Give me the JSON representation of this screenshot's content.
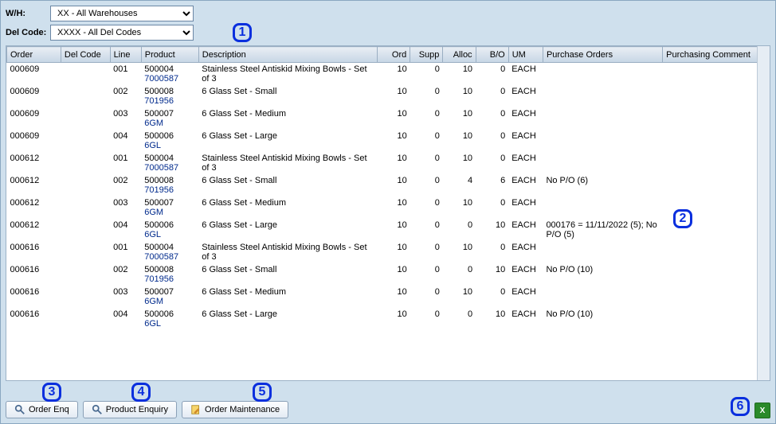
{
  "filters": {
    "wh_label": "W/H:",
    "wh_value": "XX - All Warehouses",
    "del_label": "Del Code:",
    "del_value": "XXXX - All Del Codes"
  },
  "columns": {
    "order": "Order",
    "del_code": "Del Code",
    "line": "Line",
    "product": "Product",
    "description": "Description",
    "ord": "Ord",
    "supp": "Supp",
    "alloc": "Alloc",
    "bo": "B/O",
    "um": "UM",
    "po": "Purchase Orders",
    "pc": "Purchasing Comment"
  },
  "rows": [
    {
      "order": "000609",
      "del": "",
      "line": "001",
      "prod1": "500004",
      "prod2": "7000587",
      "desc": "Stainless Steel Antiskid Mixing Bowls - Set of 3",
      "ord": "10",
      "supp": "0",
      "alloc": "10",
      "bo": "0",
      "um": "EACH",
      "po": "",
      "pc": ""
    },
    {
      "order": "000609",
      "del": "",
      "line": "002",
      "prod1": "500008",
      "prod2": "701956",
      "desc": "6 Glass Set - Small",
      "ord": "10",
      "supp": "0",
      "alloc": "10",
      "bo": "0",
      "um": "EACH",
      "po": "",
      "pc": ""
    },
    {
      "order": "000609",
      "del": "",
      "line": "003",
      "prod1": "500007",
      "prod2": "6GM",
      "desc": "6 Glass Set - Medium",
      "ord": "10",
      "supp": "0",
      "alloc": "10",
      "bo": "0",
      "um": "EACH",
      "po": "",
      "pc": ""
    },
    {
      "order": "000609",
      "del": "",
      "line": "004",
      "prod1": "500006",
      "prod2": "6GL",
      "desc": "6 Glass Set - Large",
      "ord": "10",
      "supp": "0",
      "alloc": "10",
      "bo": "0",
      "um": "EACH",
      "po": "",
      "pc": ""
    },
    {
      "order": "000612",
      "del": "",
      "line": "001",
      "prod1": "500004",
      "prod2": "7000587",
      "desc": "Stainless Steel Antiskid Mixing Bowls - Set of 3",
      "ord": "10",
      "supp": "0",
      "alloc": "10",
      "bo": "0",
      "um": "EACH",
      "po": "",
      "pc": ""
    },
    {
      "order": "000612",
      "del": "",
      "line": "002",
      "prod1": "500008",
      "prod2": "701956",
      "desc": "6 Glass Set - Small",
      "ord": "10",
      "supp": "0",
      "alloc": "4",
      "bo": "6",
      "um": "EACH",
      "po": "No P/O (6)",
      "pc": ""
    },
    {
      "order": "000612",
      "del": "",
      "line": "003",
      "prod1": "500007",
      "prod2": "6GM",
      "desc": "6 Glass Set - Medium",
      "ord": "10",
      "supp": "0",
      "alloc": "10",
      "bo": "0",
      "um": "EACH",
      "po": "",
      "pc": ""
    },
    {
      "order": "000612",
      "del": "",
      "line": "004",
      "prod1": "500006",
      "prod2": "6GL",
      "desc": "6 Glass Set - Large",
      "ord": "10",
      "supp": "0",
      "alloc": "0",
      "bo": "10",
      "um": "EACH",
      "po": "000176 = 11/11/2022 (5); No P/O (5)",
      "pc": ""
    },
    {
      "order": "000616",
      "del": "",
      "line": "001",
      "prod1": "500004",
      "prod2": "7000587",
      "desc": "Stainless Steel Antiskid Mixing Bowls - Set of 3",
      "ord": "10",
      "supp": "0",
      "alloc": "10",
      "bo": "0",
      "um": "EACH",
      "po": "",
      "pc": ""
    },
    {
      "order": "000616",
      "del": "",
      "line": "002",
      "prod1": "500008",
      "prod2": "701956",
      "desc": "6 Glass Set - Small",
      "ord": "10",
      "supp": "0",
      "alloc": "0",
      "bo": "10",
      "um": "EACH",
      "po": "No P/O (10)",
      "pc": ""
    },
    {
      "order": "000616",
      "del": "",
      "line": "003",
      "prod1": "500007",
      "prod2": "6GM",
      "desc": "6 Glass Set - Medium",
      "ord": "10",
      "supp": "0",
      "alloc": "10",
      "bo": "0",
      "um": "EACH",
      "po": "",
      "pc": ""
    },
    {
      "order": "000616",
      "del": "",
      "line": "004",
      "prod1": "500006",
      "prod2": "6GL",
      "desc": "6 Glass Set - Large",
      "ord": "10",
      "supp": "0",
      "alloc": "0",
      "bo": "10",
      "um": "EACH",
      "po": "No P/O (10)",
      "pc": ""
    }
  ],
  "buttons": {
    "order_enq": "Order Enq",
    "product_enq": "Product Enquiry",
    "order_maint": "Order Maintenance"
  },
  "callouts": {
    "c1": "1",
    "c2": "2",
    "c3": "3",
    "c4": "4",
    "c5": "5",
    "c6": "6"
  },
  "export_glyph": "X"
}
